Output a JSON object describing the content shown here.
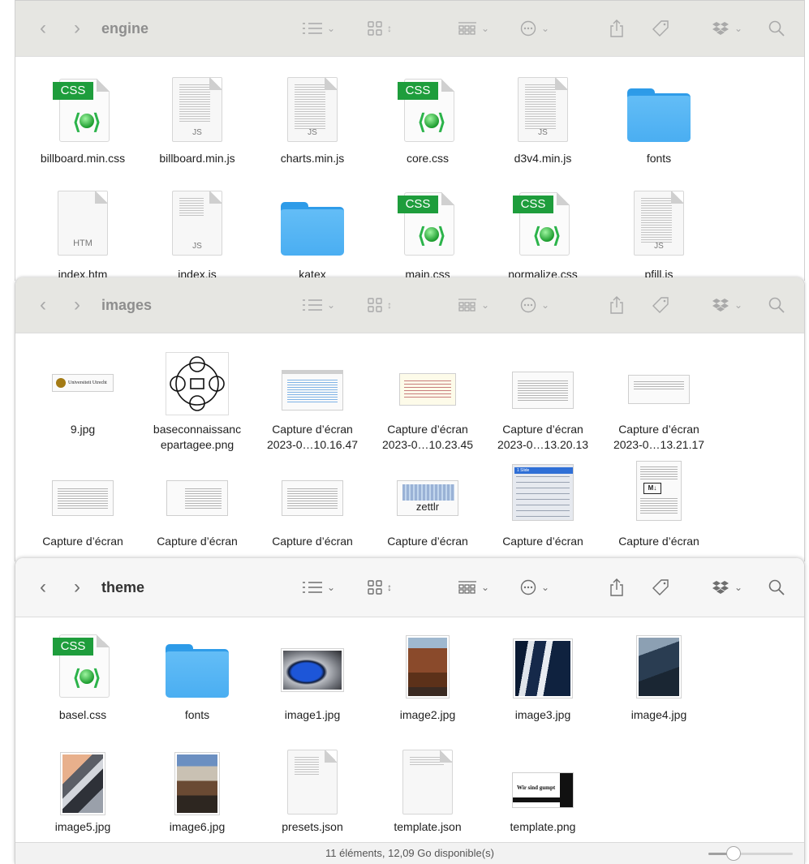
{
  "windows": [
    {
      "title": "engine",
      "items": [
        {
          "label": "billboard.min.css",
          "icon": "css-file-icon"
        },
        {
          "label": "billboard.min.js",
          "icon": "js-file-icon",
          "ext": "JS"
        },
        {
          "label": "charts.min.js",
          "icon": "js-file-icon",
          "ext": "JS"
        },
        {
          "label": "core.css",
          "icon": "css-file-icon"
        },
        {
          "label": "d3v4.min.js",
          "icon": "js-file-icon",
          "ext": "JS"
        },
        {
          "label": "fonts",
          "icon": "folder-icon"
        },
        {
          "label": "index.htm",
          "icon": "htm-file-icon",
          "ext": "HTM"
        },
        {
          "label": "index.js",
          "icon": "js-file-icon",
          "ext": "JS"
        },
        {
          "label": "katex",
          "icon": "folder-icon"
        },
        {
          "label": "main.css",
          "icon": "css-file-icon"
        },
        {
          "label": "normalize.css",
          "icon": "css-file-icon"
        },
        {
          "label": "pfill.js",
          "icon": "js-file-icon",
          "ext": "JS"
        }
      ]
    },
    {
      "title": "images",
      "items": [
        {
          "label": "9.jpg",
          "thumb_text": "Universiteit Utrecht"
        },
        {
          "label": "baseconnaissanc\nepartagee.png"
        },
        {
          "label": "Capture d’écran\n2023-0…10.16.47"
        },
        {
          "label": "Capture d’écran\n2023-0…10.23.45"
        },
        {
          "label": "Capture d’écran\n2023-0…13.20.13"
        },
        {
          "label": "Capture d’écran\n2023-0…13.21.17"
        },
        {
          "label": "Capture d’écran"
        },
        {
          "label": "Capture d’écran"
        },
        {
          "label": "Capture d’écran"
        },
        {
          "label": "Capture d’écran",
          "thumb_text": "zettlr"
        },
        {
          "label": "Capture d’écran",
          "thumb_text": "1 Slide"
        },
        {
          "label": "Capture d’écran",
          "thumb_text": "M↓"
        }
      ]
    },
    {
      "title": "theme",
      "items": [
        {
          "label": "basel.css",
          "icon": "css-file-icon"
        },
        {
          "label": "fonts",
          "icon": "folder-icon"
        },
        {
          "label": "image1.jpg"
        },
        {
          "label": "image2.jpg"
        },
        {
          "label": "image3.jpg"
        },
        {
          "label": "image4.jpg"
        },
        {
          "label": "image5.jpg"
        },
        {
          "label": "image6.jpg"
        },
        {
          "label": "presets.json",
          "icon": "json-file-icon"
        },
        {
          "label": "template.json",
          "icon": "json-file-icon"
        },
        {
          "label": "template.png",
          "thumb_text": "Wir sind gumpt"
        }
      ],
      "status": "11 éléments, 12,09 Go disponible(s)",
      "zoom_level": 0.25
    }
  ],
  "badge_text": "CSS",
  "colors": {
    "css_badge": "#1e9d3c",
    "folder": "#4aaef2"
  }
}
